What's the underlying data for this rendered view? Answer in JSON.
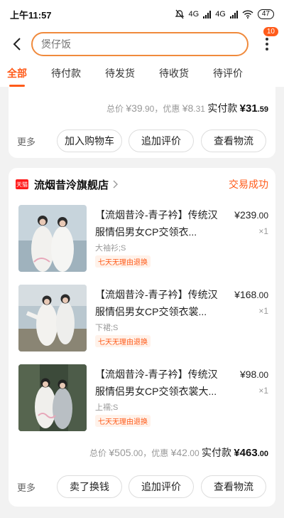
{
  "status_bar": {
    "time": "上午11:57",
    "network_1": "4G",
    "network_2": "4G",
    "battery": "47"
  },
  "header": {
    "search_placeholder": "煲仔饭",
    "badge_count": "10"
  },
  "tabs": [
    {
      "label": "全部",
      "active": true
    },
    {
      "label": "待付款"
    },
    {
      "label": "待发货"
    },
    {
      "label": "待收货"
    },
    {
      "label": "待评价"
    }
  ],
  "order_prev": {
    "total_label": "总价",
    "total_int": "¥39",
    "total_dec": ".90",
    "discount_label": "，优惠",
    "discount_int": "¥8",
    "discount_dec": ".31",
    "paid_label": "实付款",
    "paid_int": "¥31",
    "paid_dec": ".59",
    "more": "更多",
    "buttons": [
      "加入购物车",
      "追加评价",
      "查看物流"
    ]
  },
  "order": {
    "shop_badge": "天猫",
    "shop_name": "流烟昔泠旗舰店",
    "status": "交易成功",
    "items": [
      {
        "title": "【流烟昔泠-青子衿】传统汉服情侣男女CP交领衣...",
        "spec": "大袖衫;S",
        "tag": "七天无理由退换",
        "price_int": "¥239",
        "price_dec": ".00",
        "qty": "×1"
      },
      {
        "title": "【流烟昔泠-青子衿】传统汉服情侣男女CP交领衣裳...",
        "spec": "下裙;S",
        "tag": "七天无理由退换",
        "price_int": "¥168",
        "price_dec": ".00",
        "qty": "×1"
      },
      {
        "title": "【流烟昔泠-青子衿】传统汉服情侣男女CP交领衣裳大...",
        "spec": "上襦;S",
        "tag": "七天无理由退换",
        "price_int": "¥98",
        "price_dec": ".00",
        "qty": "×1"
      }
    ],
    "total_label": "总价",
    "total_int": "¥505",
    "total_dec": ".00",
    "discount_label": "，优惠",
    "discount_int": "¥42",
    "discount_dec": ".00",
    "paid_label": "实付款",
    "paid_int": "¥463",
    "paid_dec": ".00",
    "more": "更多",
    "buttons": [
      "卖了换钱",
      "追加评价",
      "查看物流"
    ]
  },
  "colors": {
    "accent": "#ff5b1a",
    "search_border": "#f08a3c",
    "tmall_red": "#ff1a1a"
  }
}
